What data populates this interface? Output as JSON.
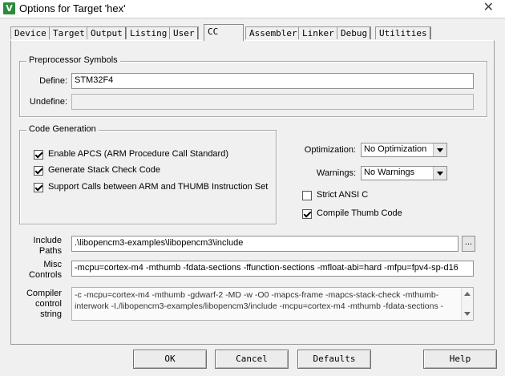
{
  "window": {
    "title": "Options for Target 'hex'",
    "close_glyph": "✕",
    "app_icon_glyph": "V"
  },
  "tabs": [
    {
      "label": "Device"
    },
    {
      "label": "Target"
    },
    {
      "label": "Output"
    },
    {
      "label": "Listing"
    },
    {
      "label": "User"
    },
    {
      "label": "CC",
      "active": true
    },
    {
      "label": "Assembler"
    },
    {
      "label": "Linker"
    },
    {
      "label": "Debug"
    },
    {
      "label": "Utilities"
    }
  ],
  "preprocessor": {
    "title": "Preprocessor Symbols",
    "define_label": "Define:",
    "define_value": "STM32F4",
    "undefine_label": "Undefine:",
    "undefine_value": ""
  },
  "code_generation": {
    "title": "Code Generation",
    "options": [
      {
        "label": "Enable APCS (ARM Procedure Call Standard)",
        "checked": true
      },
      {
        "label": "Generate Stack Check Code",
        "checked": true
      },
      {
        "label": "Support Calls between ARM and THUMB Instruction Set",
        "checked": true
      }
    ]
  },
  "optimization": {
    "label": "Optimization:",
    "value": "No Optimization"
  },
  "warnings": {
    "label": "Warnings:",
    "value": "No Warnings"
  },
  "strict_ansi": {
    "label": "Strict ANSI C",
    "checked": false
  },
  "compile_thumb": {
    "label": "Compile Thumb Code",
    "checked": true
  },
  "include_paths": {
    "label_line1": "Include",
    "label_line2": "Paths",
    "value": ".\\libopencm3-examples\\libopencm3\\include",
    "browse_label": "..."
  },
  "misc_controls": {
    "label_line1": "Misc",
    "label_line2": "Controls",
    "value": "-mcpu=cortex-m4 -mthumb -fdata-sections -ffunction-sections  -mfloat-abi=hard -mfpu=fpv4-sp-d16"
  },
  "compiler_control": {
    "label_line1": "Compiler",
    "label_line2": "control",
    "label_line3": "string",
    "line1": "-c -mcpu=cortex-m4 -mthumb -gdwarf-2 -MD -w -O0 -mapcs-frame -mapcs-stack-check -mthumb-",
    "line2": "interwork -I./libopencm3-examples/libopencm3/include -mcpu=cortex-m4 -mthumb -fdata-sections -"
  },
  "buttons": {
    "ok": "OK",
    "cancel": "Cancel",
    "defaults": "Defaults",
    "help": "Help"
  }
}
